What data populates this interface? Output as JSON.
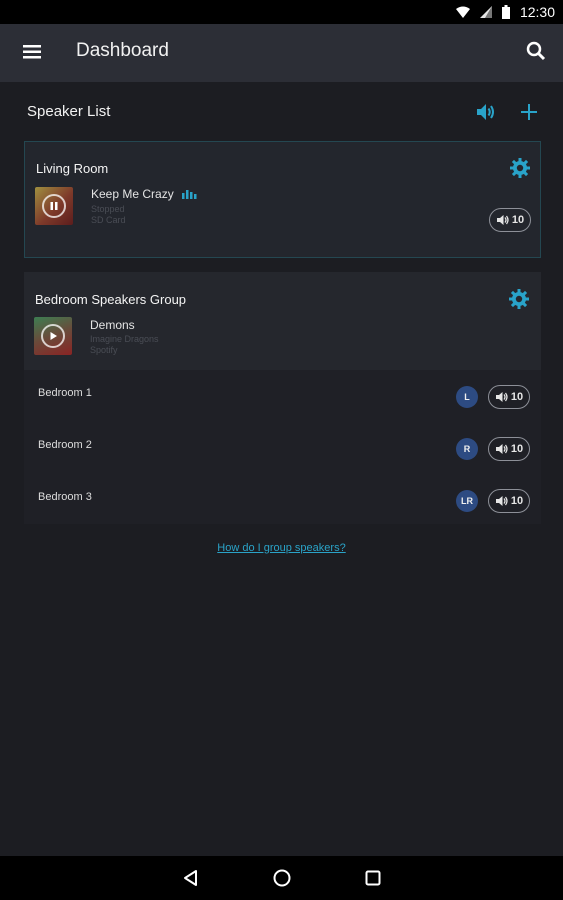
{
  "status_bar": {
    "time": "12:30"
  },
  "app_bar": {
    "title": "Dashboard"
  },
  "speaker_list": {
    "title": "Speaker List"
  },
  "living_room": {
    "name": "Living Room",
    "track": "Keep Me Crazy",
    "state": "Stopped",
    "source": "SD Card",
    "volume": "10"
  },
  "bedroom_group": {
    "name": "Bedroom Speakers Group",
    "track": "Demons",
    "artist": "Imagine Dragons",
    "source": "Spotify",
    "members": [
      {
        "name": "Bedroom 1",
        "channel": "L",
        "volume": "10"
      },
      {
        "name": "Bedroom 2",
        "channel": "R",
        "volume": "10"
      },
      {
        "name": "Bedroom 3",
        "channel": "LR",
        "volume": "10"
      }
    ]
  },
  "help_link": "How do I group speakers?",
  "colors": {
    "accent": "#29a3c9",
    "badge": "#2d4b82",
    "appbar": "#2c2e36",
    "background": "#1c1d22"
  },
  "icons": [
    "wifi-icon",
    "signal-icon",
    "battery-icon",
    "menu-icon",
    "search-icon",
    "speaker-icon",
    "add-icon",
    "gear-icon",
    "pause-icon",
    "play-icon",
    "equalizer-icon",
    "volume-icon",
    "back-icon",
    "home-icon",
    "recents-icon"
  ]
}
